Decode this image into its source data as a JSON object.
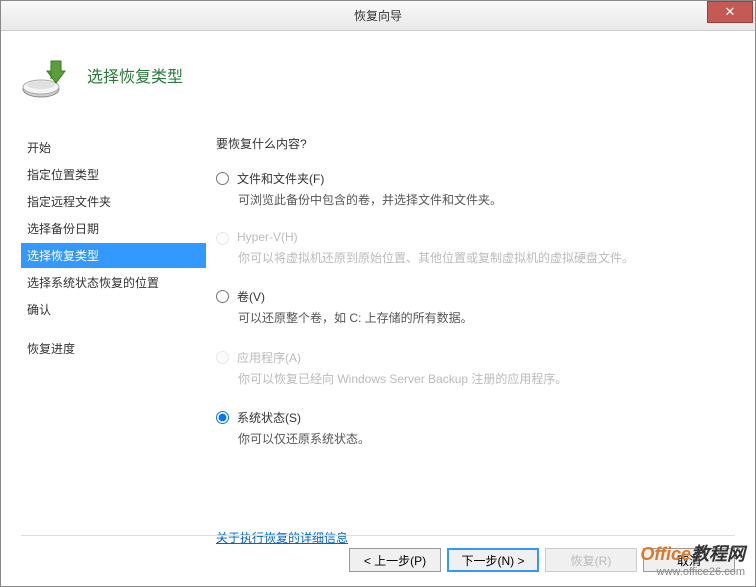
{
  "window": {
    "title": "恢复向导",
    "close_tooltip": "关闭"
  },
  "header": {
    "title": "选择恢复类型"
  },
  "sidebar": {
    "items": [
      {
        "label": "开始"
      },
      {
        "label": "指定位置类型"
      },
      {
        "label": "指定远程文件夹"
      },
      {
        "label": "选择备份日期"
      },
      {
        "label": "选择恢复类型"
      },
      {
        "label": "选择系统状态恢复的位置"
      },
      {
        "label": "确认"
      },
      {
        "label": "恢复进度"
      }
    ]
  },
  "content": {
    "question": "要恢复什么内容?",
    "options": [
      {
        "label": "文件和文件夹(F)",
        "desc": "可浏览此备份中包含的卷，并选择文件和文件夹。"
      },
      {
        "label": "Hyper-V(H)",
        "desc": "你可以将虚拟机还原到原始位置、其他位置或复制虚拟机的虚拟硬盘文件。"
      },
      {
        "label": "卷(V)",
        "desc": "可以还原整个卷，如 C: 上存储的所有数据。"
      },
      {
        "label": "应用程序(A)",
        "desc": "你可以恢复已经向 Windows Server Backup 注册的应用程序。"
      },
      {
        "label": "系统状态(S)",
        "desc": "你可以仅还原系统状态。"
      }
    ],
    "details_link": "关于执行恢复的详细信息"
  },
  "buttons": {
    "prev": "< 上一步(P)",
    "next": "下一步(N) >",
    "recover": "恢复(R)",
    "cancel": "取消"
  },
  "watermark": {
    "brand1": "Office",
    "brand2": "教程网",
    "url": "www.office26.com"
  }
}
